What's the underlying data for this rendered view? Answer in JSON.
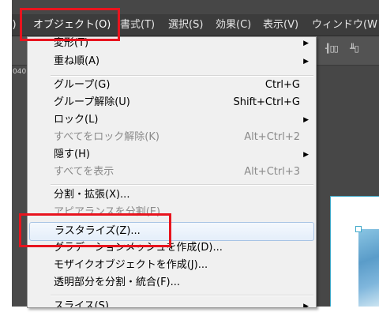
{
  "menubar": {
    "items": [
      {
        "label": "ｪ)"
      },
      {
        "label": "オブジェクト(O)"
      },
      {
        "label": "書式(T)"
      },
      {
        "label": "選択(S)"
      },
      {
        "label": "効果(C)"
      },
      {
        "label": "表示(V)"
      },
      {
        "label": "ウィンドウ(W"
      }
    ]
  },
  "toolbar": {
    "align_icon_1": "╢▯▯",
    "align_icon_2": "╨▯"
  },
  "sidebar": {
    "value": "040"
  },
  "object_menu": {
    "items": [
      {
        "label": "変形(T)",
        "shortcut": "",
        "submenu": true,
        "disabled": false
      },
      {
        "label": "重ね順(A)",
        "shortcut": "",
        "submenu": true,
        "disabled": false
      },
      {
        "label": "グループ(G)",
        "shortcut": "Ctrl+G",
        "submenu": false,
        "disabled": false
      },
      {
        "label": "グループ解除(U)",
        "shortcut": "Shift+Ctrl+G",
        "submenu": false,
        "disabled": false
      },
      {
        "label": "ロック(L)",
        "shortcut": "",
        "submenu": true,
        "disabled": false
      },
      {
        "label": "すべてをロック解除(K)",
        "shortcut": "Alt+Ctrl+2",
        "submenu": false,
        "disabled": true
      },
      {
        "label": "隠す(H)",
        "shortcut": "",
        "submenu": true,
        "disabled": false
      },
      {
        "label": "すべてを表示",
        "shortcut": "Alt+Ctrl+3",
        "submenu": false,
        "disabled": true
      },
      {
        "label": "分割・拡張(X)...",
        "shortcut": "",
        "submenu": false,
        "disabled": false
      },
      {
        "label": "アピアランスを分割(E)",
        "shortcut": "",
        "submenu": false,
        "disabled": true
      },
      {
        "label": "ラスタライズ(Z)...",
        "shortcut": "",
        "submenu": false,
        "disabled": false,
        "highlighted": true
      },
      {
        "label": "グラデーションメッシュを作成(D)...",
        "shortcut": "",
        "submenu": false,
        "disabled": false
      },
      {
        "label": "モザイクオブジェクトを作成(J)...",
        "shortcut": "",
        "submenu": false,
        "disabled": false
      },
      {
        "label": "透明部分を分割・統合(F)...",
        "shortcut": "",
        "submenu": false,
        "disabled": false
      },
      {
        "label": "スライス(S)",
        "shortcut": "",
        "submenu": true,
        "disabled": false
      }
    ],
    "submenu_arrow": "▶"
  },
  "colors": {
    "highlight_box": "#e8141e",
    "menu_bg": "#f0f0f0",
    "menubar_bg": "#3c3c3c"
  }
}
